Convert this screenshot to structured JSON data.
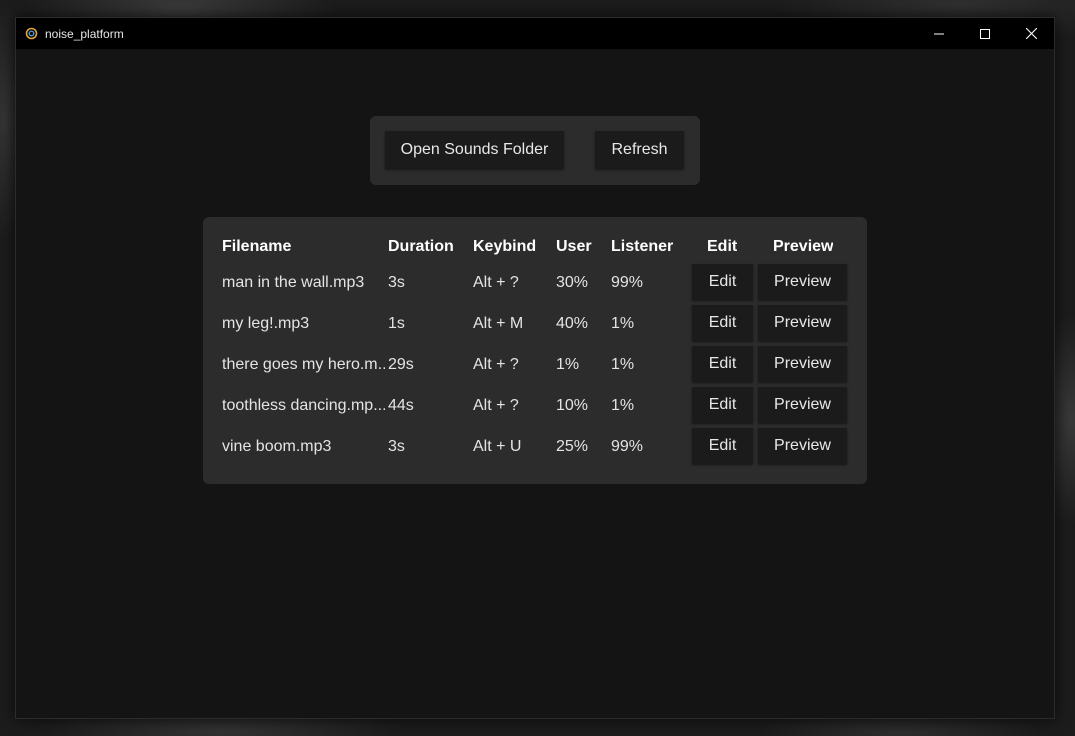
{
  "window": {
    "title": "noise_platform"
  },
  "toolbar": {
    "open_label": "Open Sounds Folder",
    "refresh_label": "Refresh"
  },
  "table": {
    "headers": {
      "filename": "Filename",
      "duration": "Duration",
      "keybind": "Keybind",
      "user": "User",
      "listener": "Listener",
      "edit": "Edit",
      "preview": "Preview"
    },
    "rows": [
      {
        "filename": "man in the wall.mp3",
        "duration": "3s",
        "keybind": "Alt + ?",
        "user": "30%",
        "listener": "99%",
        "edit": "Edit",
        "preview": "Preview"
      },
      {
        "filename": "my leg!.mp3",
        "duration": "1s",
        "keybind": "Alt + M",
        "user": "40%",
        "listener": "1%",
        "edit": "Edit",
        "preview": "Preview"
      },
      {
        "filename": "there goes my hero.m...",
        "duration": "29s",
        "keybind": "Alt + ?",
        "user": "1%",
        "listener": "1%",
        "edit": "Edit",
        "preview": "Preview"
      },
      {
        "filename": "toothless dancing.mp...",
        "duration": "44s",
        "keybind": "Alt + ?",
        "user": "10%",
        "listener": "1%",
        "edit": "Edit",
        "preview": "Preview"
      },
      {
        "filename": "vine boom.mp3",
        "duration": "3s",
        "keybind": "Alt + U",
        "user": "25%",
        "listener": "99%",
        "edit": "Edit",
        "preview": "Preview"
      }
    ]
  },
  "icons": {
    "app": "app-logo-icon",
    "minimize": "minimize-icon",
    "maximize": "maximize-icon",
    "close": "close-icon"
  }
}
